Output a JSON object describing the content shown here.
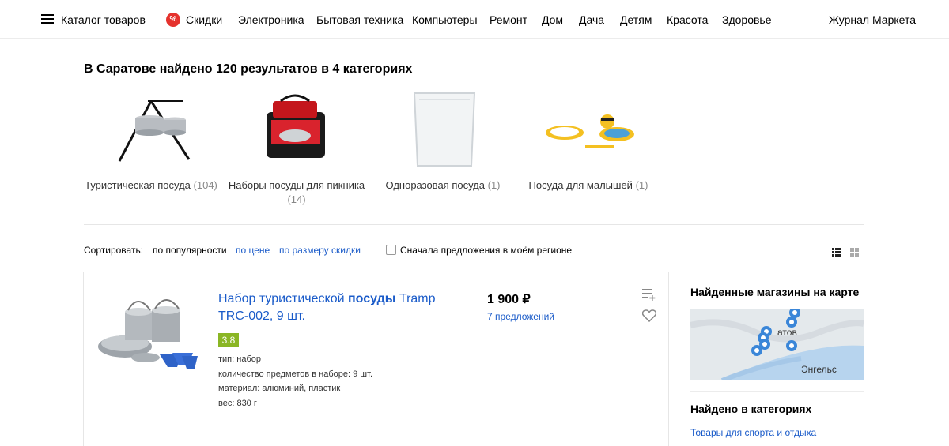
{
  "nav": {
    "catalog": "Каталог товаров",
    "sale_icon": "%",
    "sale": "Скидки",
    "items": [
      "Электроника",
      "Бытовая техника",
      "Компьютеры",
      "Ремонт",
      "Дом",
      "Дача",
      "Детям",
      "Красота",
      "Здоровье"
    ],
    "journal": "Журнал Маркета"
  },
  "results": {
    "title": "В Саратове найдено 120 результатов в 4 категориях",
    "categories": [
      {
        "name": "Туристическая посуда",
        "count": "(104)",
        "icon": "camping-cookware-image"
      },
      {
        "name": "Наборы посуды для пикника",
        "count": "(14)",
        "icon": "picnic-bag-image"
      },
      {
        "name": "Одноразовая посуда",
        "count": "(1)",
        "icon": "disposable-container-image"
      },
      {
        "name": "Посуда для малышей",
        "count": "(1)",
        "icon": "kids-dishes-image"
      }
    ]
  },
  "sort": {
    "label": "Сортировать:",
    "options": [
      "по популярности",
      "по цене",
      "по размеру скидки"
    ],
    "region_checkbox": "Сначала предложения в моём регионе"
  },
  "product": {
    "title_a": "Набор туристической ",
    "title_b": "посуды",
    "title_c": " Tramp TRC-002, 9 шт.",
    "rating": "3.8",
    "specs": [
      "тип: набор",
      "количество предметов в наборе: 9 шт.",
      "материал: алюминий, пластик",
      "вес: 830 г"
    ],
    "price": "1 900 ₽",
    "offers": "7 предложений"
  },
  "sidebar": {
    "map_title": "Найденные магазины на карте",
    "map_labels": [
      "атов",
      "Энгельс"
    ],
    "categories_title": "Найдено в категориях",
    "category_link": "Товары для спорта и отдыха"
  },
  "colors": {
    "link": "#1a5bc9",
    "rating": "#8ab624",
    "sale": "#e5322d"
  }
}
